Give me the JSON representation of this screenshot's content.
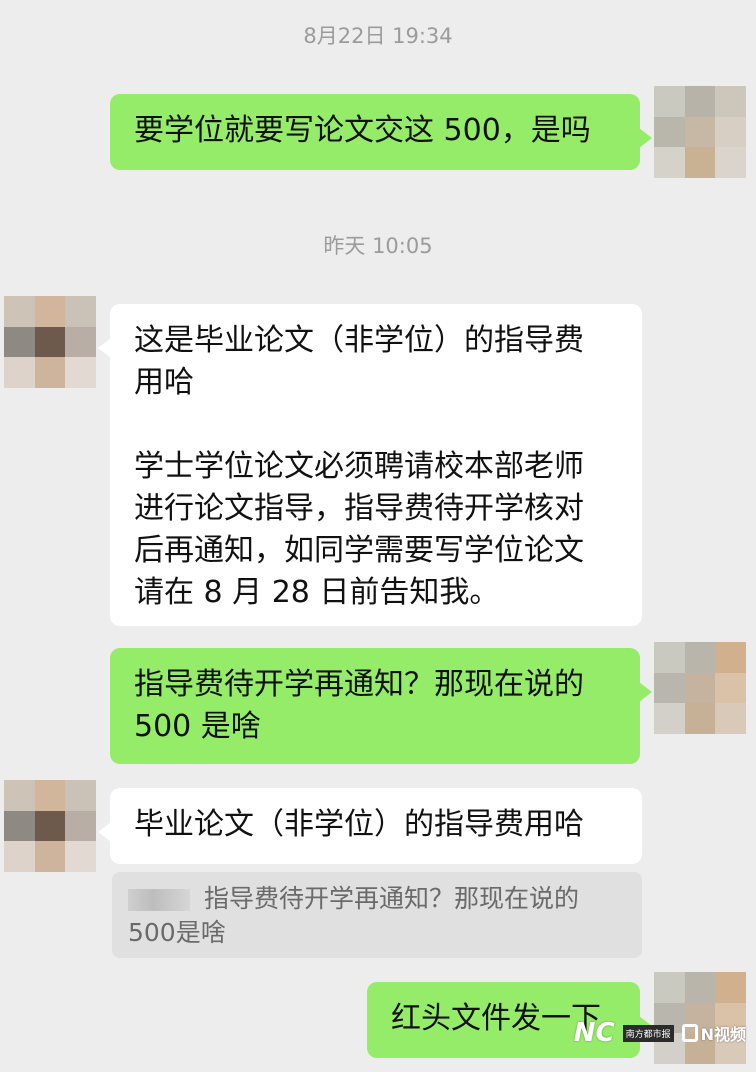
{
  "timestamps": [
    "8月22日 19:34",
    "昨天 10:05"
  ],
  "messages": [
    {
      "from": "me",
      "text": "要学位就要写论文交这 500，是吗"
    },
    {
      "from": "other",
      "text": "这是毕业论文（非学位）的指导费\n用哈\n\n学士学位论文必须聘请校本部老师\n进行论文指导，指导费待开学核对\n后再通知，如同学需要写学位论文\n请在 8 月 28 日前告知我。"
    },
    {
      "from": "me",
      "text": "指导费待开学再通知？那现在说的\n500 是啥"
    },
    {
      "from": "other",
      "text": "毕业论文（非学位）的指导费用哈"
    },
    {
      "from": "me",
      "text": "红头文件发一下"
    }
  ],
  "quote": {
    "text": "指导费待开学再通知？那现在说的\n500是啥"
  },
  "watermark": {
    "logo": "NC",
    "box": "南方都市报",
    "brand": "N视频"
  },
  "colors": {
    "background": "#ededed",
    "me_bubble": "#95ec69",
    "other_bubble": "#ffffff"
  }
}
